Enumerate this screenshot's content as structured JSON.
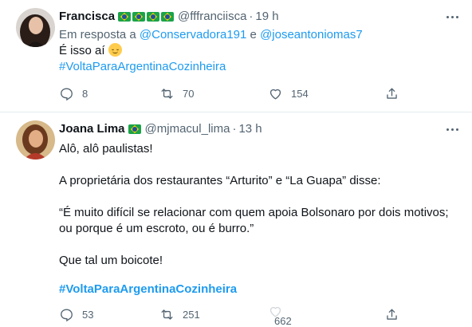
{
  "tweets": [
    {
      "name": "Francisca",
      "handle": "@fffranciisca",
      "time": "19 h",
      "reply_prefix": "Em resposta a",
      "reply_to_1": "@Conservadora191",
      "reply_joiner": "e",
      "reply_to_2": "@joseantoniomas7",
      "text_line": "É isso aí",
      "emoji": "relieved-face",
      "hashtag": "#VoltaParaArgentinaCozinheira",
      "flags_count": 4,
      "replies": "8",
      "retweets": "70",
      "likes": "154"
    },
    {
      "name": "Joana Lima",
      "handle": "@mjmacul_lima",
      "time": "13 h",
      "line1": "Alô, alô paulistas!",
      "line2": "A proprietária dos restaurantes “Arturito” e “La Guapa” disse:",
      "line3": "“É muito difícil se relacionar com quem apoia Bolsonaro por dois motivos;",
      "line4": "ou porque é um escroto, ou é burro.”",
      "line5": "Que tal um boicote!",
      "hashtag": "#VoltaParaArgentinaCozinheira",
      "flags_count": 1,
      "replies": "53",
      "retweets": "251",
      "likes": "662"
    }
  ],
  "colors": {
    "link": "#1d9bf0",
    "muted": "#536471",
    "text": "#0f1419",
    "divider": "#e6ecf0"
  }
}
